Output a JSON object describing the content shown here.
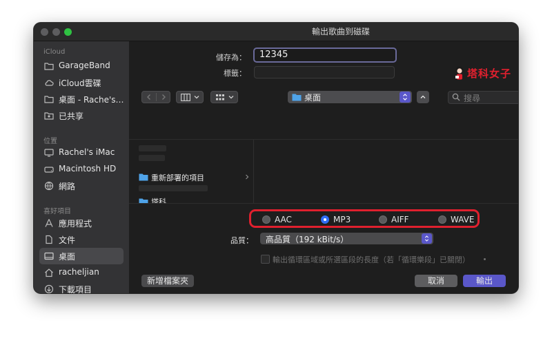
{
  "window": {
    "title": "輸出歌曲到磁碟"
  },
  "sidebar": {
    "sections": [
      {
        "title": "iCloud",
        "items": [
          {
            "label": "GarageBand",
            "icon": "folder-icon"
          },
          {
            "label": "iCloud雲碟",
            "icon": "cloud-icon"
          },
          {
            "label": "桌面 - Rache's…",
            "icon": "folder-icon"
          },
          {
            "label": "已共享",
            "icon": "shared-folder-icon"
          }
        ]
      },
      {
        "title": "位置",
        "items": [
          {
            "label": "Rachel's iMac",
            "icon": "imac-icon"
          },
          {
            "label": "Macintosh HD",
            "icon": "drive-icon"
          },
          {
            "label": "網路",
            "icon": "globe-icon"
          }
        ]
      },
      {
        "title": "喜好項目",
        "items": [
          {
            "label": "應用程式",
            "icon": "apps-icon"
          },
          {
            "label": "文件",
            "icon": "document-icon"
          },
          {
            "label": "桌面",
            "icon": "desktop-icon",
            "selected": true
          },
          {
            "label": "racheljian",
            "icon": "home-icon"
          },
          {
            "label": "下載項目",
            "icon": "download-icon"
          }
        ]
      }
    ]
  },
  "form": {
    "save_as_label": "儲存為：",
    "save_as_value": "12345",
    "tags_label": "標籤：",
    "tags_value": "",
    "location_value": "桌面",
    "search_placeholder": "搜尋"
  },
  "browser": {
    "items": [
      "重新部署的項目",
      "塔科"
    ]
  },
  "watermark": "塔科女子",
  "format": {
    "options": [
      {
        "label": "AAC",
        "selected": false
      },
      {
        "label": "MP3",
        "selected": true
      },
      {
        "label": "AIFF",
        "selected": false
      },
      {
        "label": "WAVE",
        "selected": false
      }
    ],
    "highlight_color": "#e0202e"
  },
  "quality": {
    "label": "品質：",
    "value": "高品質（192 kBit/s）"
  },
  "cycle_option": {
    "label": "輸出循環區域或所選區段的長度（若「循環樂段」已關閉）",
    "checked": false
  },
  "buttons": {
    "new_folder": "新增檔案夾",
    "cancel": "取消",
    "export": "輸出"
  },
  "colors": {
    "accent": "#5a57c9",
    "window_bg": "#1e1e1e",
    "sidebar_bg": "#333335"
  }
}
